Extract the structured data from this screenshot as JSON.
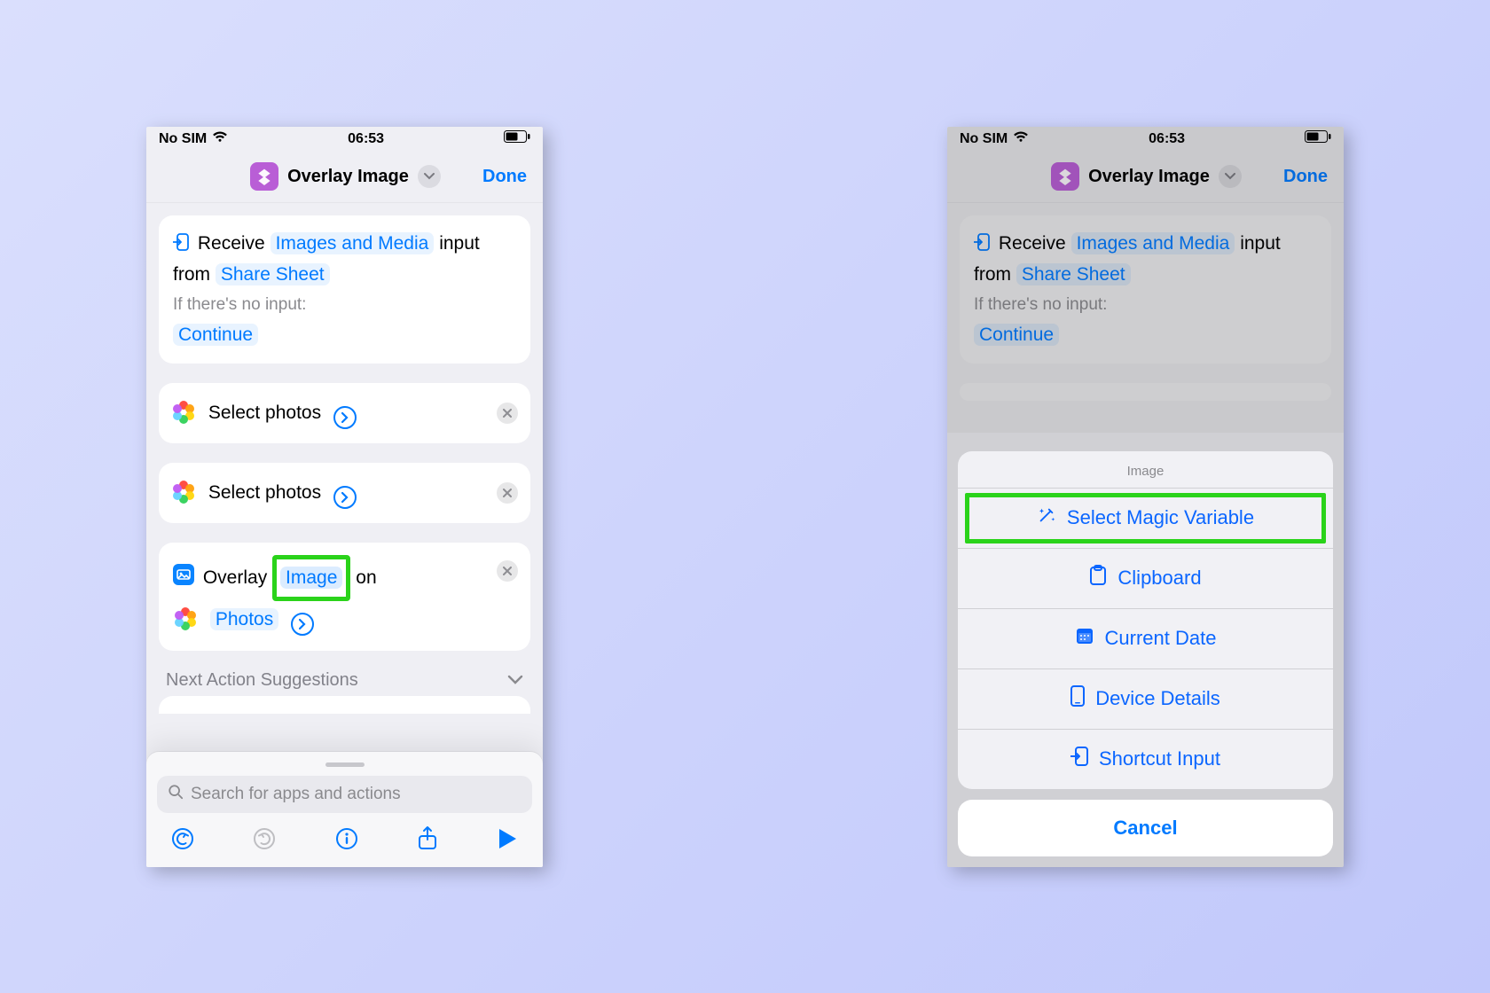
{
  "status": {
    "carrier": "No SIM",
    "time": "06:53"
  },
  "nav": {
    "title": "Overlay Image",
    "done": "Done"
  },
  "receive_card": {
    "receive": "Receive",
    "types": "Images and Media",
    "input_from": "input from",
    "source": "Share Sheet",
    "no_input_label": "If there's no input:",
    "fallback": "Continue"
  },
  "select_photos_label": "Select photos",
  "overlay_card": {
    "verb": "Overlay",
    "image_token": "Image",
    "on": "on",
    "photos_token": "Photos"
  },
  "suggestions_label": "Next Action Suggestions",
  "search_placeholder": "Search for apps and actions",
  "sheet": {
    "header": "Image",
    "items": {
      "magic": "Select Magic Variable",
      "clipboard": "Clipboard",
      "date": "Current Date",
      "device": "Device Details",
      "input": "Shortcut Input"
    },
    "cancel": "Cancel"
  }
}
